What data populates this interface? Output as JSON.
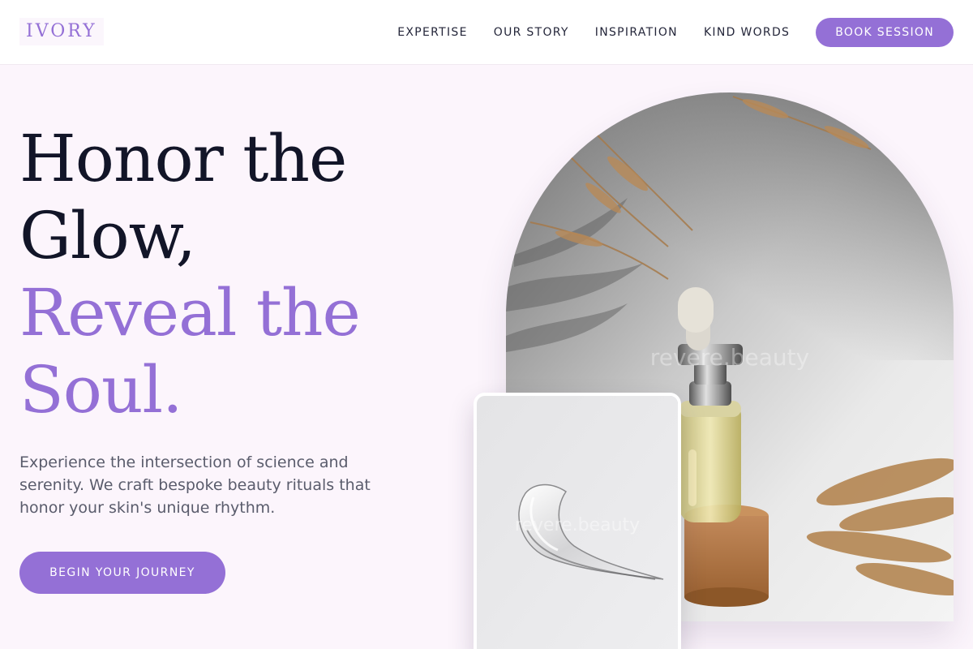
{
  "header": {
    "logo": "IVORY",
    "nav": [
      "EXPERTISE",
      "OUR STORY",
      "INSPIRATION",
      "KIND WORDS"
    ],
    "cta": "BOOK SESSION"
  },
  "hero": {
    "headline_line1": "Honor the",
    "headline_line2": "Glow,",
    "headline_line3": "Reveal the",
    "headline_line4": "Soul.",
    "subtext": "Experience the intersection of science and serenity. We craft bespoke beauty rituals that honor your skin's unique rhythm.",
    "cta": "BEGIN YOUR JOURNEY"
  },
  "images": {
    "arch_watermark": "revere.beauty",
    "card_watermark": "revere.beauty"
  },
  "colors": {
    "accent": "#9470d6",
    "background": "#fcf5fc",
    "dark_text": "#121528"
  }
}
